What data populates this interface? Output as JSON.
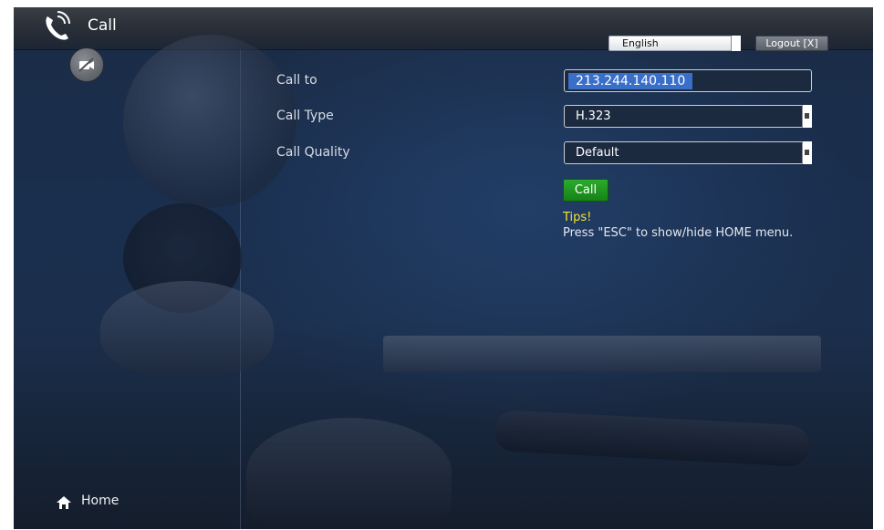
{
  "header": {
    "title": "Call",
    "call_icon": "phone-ringing-icon",
    "camera_icon": "camera-off-icon"
  },
  "topbar": {
    "language": "English",
    "logout_label": "Logout [X]"
  },
  "form": {
    "call_to_label": "Call to",
    "call_to_value": "213.244.140.110",
    "call_type_label": "Call Type",
    "call_type_value": "H.323",
    "call_quality_label": "Call Quality",
    "call_quality_value": "Default",
    "call_button_label": "Call"
  },
  "tips": {
    "title": "Tips!",
    "text": "Press \"ESC\" to show/hide HOME menu."
  },
  "footer": {
    "home_label": "Home",
    "home_icon": "home-icon"
  },
  "colors": {
    "accent_green": "#1e9a1e",
    "tips_yellow": "#f2e232",
    "selection_blue": "#3a6fc9"
  }
}
